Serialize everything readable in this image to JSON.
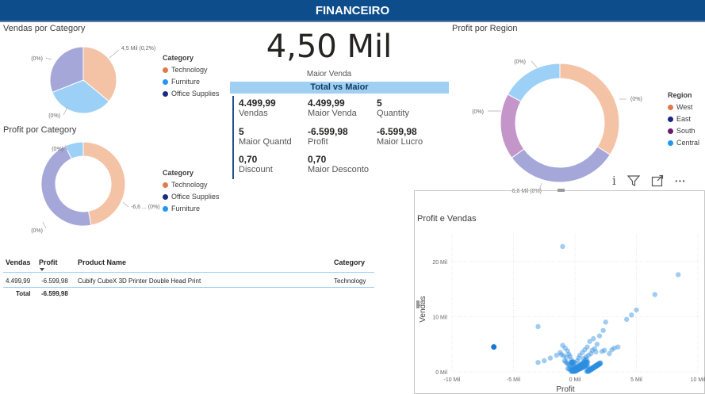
{
  "header": {
    "title": "FINANCEIRO"
  },
  "kpi": {
    "value": "4,50 Mil",
    "label": "Maior Venda"
  },
  "card": {
    "title": "Total vs Maior",
    "items": [
      {
        "value": "4.499,99",
        "label": "Vendas"
      },
      {
        "value": "4.499,99",
        "label": "Maior Venda"
      },
      {
        "value": "5",
        "label": "Quantity"
      },
      {
        "value": "5",
        "label": "Maior Quantd"
      },
      {
        "value": "-6.599,98",
        "label": "Profit"
      },
      {
        "value": "-6.599,98",
        "label": "Maior Lucro"
      },
      {
        "value": "0,70",
        "label": "Discount"
      },
      {
        "value": "0,70",
        "label": "Maior Desconto"
      }
    ]
  },
  "table": {
    "headers": [
      "Vendas",
      "Profit",
      "Product Name",
      "Category"
    ],
    "rows": [
      [
        "4.499,99",
        "-6.599,98",
        "Cubify CubeX 3D Printer Double Head Print",
        "Technology"
      ]
    ],
    "total_label": "Total",
    "total_value": "-6.599,98"
  },
  "toolbar": {
    "info": "i",
    "filter": "filter-icon",
    "focus": "focus-mode-icon",
    "more": "···"
  },
  "chart_data": [
    {
      "type": "pie",
      "title": "Vendas por Category",
      "legend_title": "Category",
      "legend_position": "right",
      "categories": [
        "Technology",
        "Furniture",
        "Office Supplies"
      ],
      "values": [
        0.36,
        0.33,
        0.31
      ],
      "colors": [
        "#f4c3a6",
        "#9dd0f7",
        "#a5a7d9"
      ],
      "legend_colors": [
        "#e07a4a",
        "#2196f3",
        "#1b2a80"
      ],
      "data_labels": [
        "4,5 Mil (0,2%)",
        "(0%)",
        "(0%)"
      ]
    },
    {
      "type": "pie",
      "subtype": "donut",
      "title": "Profit por Category",
      "legend_title": "Category",
      "legend_position": "right",
      "categories": [
        "Technology",
        "Office Supplies",
        "Furniture"
      ],
      "values": [
        0.47,
        0.46,
        0.07
      ],
      "colors": [
        "#f4c3a6",
        "#a5a7d9",
        "#9dd0f7"
      ],
      "legend_colors": [
        "#e07a4a",
        "#1b2a80",
        "#2196f3"
      ],
      "data_labels": [
        "-6,6 ... (0%)",
        "(0%)",
        "(0%)"
      ]
    },
    {
      "type": "pie",
      "subtype": "donut",
      "title": "Profit por Region",
      "legend_title": "Region",
      "legend_position": "right",
      "categories": [
        "West",
        "East",
        "South",
        "Central"
      ],
      "values": [
        0.34,
        0.31,
        0.18,
        0.17
      ],
      "colors": [
        "#f4c3a6",
        "#a5a7d9",
        "#c495c9",
        "#9dd0f7"
      ],
      "legend_colors": [
        "#e07a4a",
        "#1b2a80",
        "#6a1b70",
        "#2196f3"
      ],
      "data_labels": [
        "(0%)",
        "-6,6 Mil (0%)",
        "(0%)",
        "(0%)"
      ]
    },
    {
      "type": "scatter",
      "title": "Profit e Vendas",
      "xlabel": "Profit",
      "ylabel": "Vendas",
      "xlim": [
        -10000,
        10000
      ],
      "ylim": [
        0,
        25000
      ],
      "x_ticks": [
        "-10 Mil",
        "-5 Mil",
        "0 Mil",
        "5 Mil",
        "10 Mil"
      ],
      "y_ticks": [
        "0 Mil",
        "10 Mil",
        "20 Mil"
      ],
      "grid": true,
      "color": "#2e8fe0",
      "highlight": {
        "x": -6600,
        "y": 4500
      },
      "x": [
        -1000,
        8400,
        6500,
        5000,
        4600,
        -3000,
        2500,
        2300,
        4200,
        2000,
        1500,
        1200,
        1000,
        800,
        600,
        400,
        300,
        200,
        100,
        50,
        0,
        -50,
        -100,
        -200,
        -300,
        -400,
        -500,
        -600,
        -800,
        -1000,
        -1200,
        -1500,
        -2000,
        -2500,
        -3000,
        3500,
        3000,
        1800,
        1600,
        1400,
        2200,
        2800,
        -700,
        -900,
        -1100,
        700,
        900,
        1100,
        1300,
        1700,
        2400,
        3200,
        150,
        250,
        350,
        450,
        550,
        650,
        750,
        850,
        950,
        -150,
        -250,
        -350,
        -450,
        -550,
        -650,
        -750,
        -850,
        120,
        220,
        320,
        420,
        520,
        620,
        720,
        820,
        920,
        1020,
        80,
        180,
        280,
        380,
        480,
        580,
        680,
        780,
        880,
        980,
        -80,
        -180,
        -280,
        -380,
        -480,
        -580,
        30,
        60,
        90,
        130,
        160,
        190,
        210,
        240,
        270,
        290,
        310,
        340,
        360,
        390,
        410,
        440,
        460,
        490,
        510,
        540
      ],
      "y": [
        22700,
        17600,
        14000,
        11200,
        10300,
        8200,
        9000,
        7500,
        9500,
        6500,
        6000,
        5500,
        4500,
        4000,
        3500,
        3000,
        2500,
        2000,
        1500,
        1000,
        500,
        800,
        1200,
        1800,
        2200,
        2800,
        3200,
        3800,
        4300,
        4800,
        3500,
        3000,
        2500,
        2000,
        1700,
        4500,
        4000,
        5000,
        4200,
        3900,
        3700,
        3300,
        2600,
        2900,
        3100,
        2400,
        2700,
        3000,
        3300,
        3600,
        3900,
        4300,
        700,
        900,
        1100,
        1300,
        1500,
        1700,
        1900,
        2100,
        2300,
        600,
        800,
        1000,
        1200,
        1400,
        1600,
        1800,
        2000,
        300,
        400,
        500,
        600,
        700,
        800,
        900,
        1000,
        1100,
        1200,
        200,
        300,
        400,
        500,
        600,
        700,
        800,
        900,
        1000,
        1100,
        100,
        200,
        300,
        400,
        500,
        600,
        100,
        150,
        200,
        250,
        300,
        350,
        400,
        450,
        500,
        550,
        600,
        650,
        700,
        750,
        800,
        850,
        900,
        950,
        1000,
        1050
      ]
    }
  ]
}
